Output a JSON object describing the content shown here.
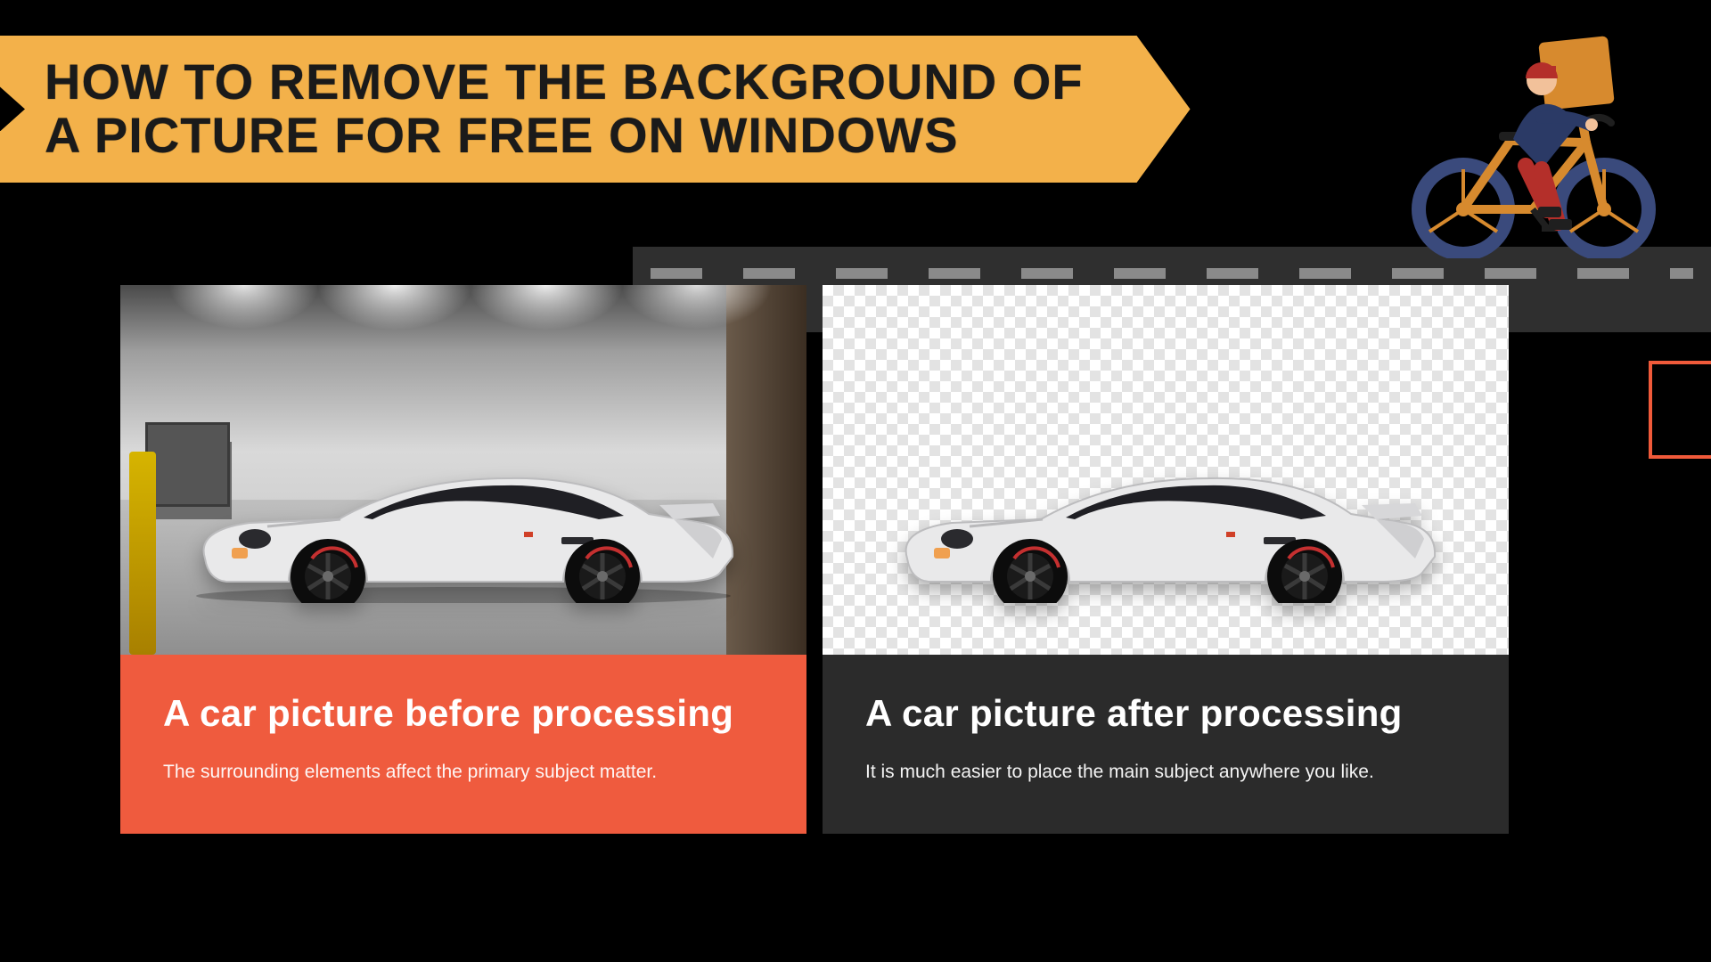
{
  "banner": {
    "title_line1": "HOW TO REMOVE THE BACKGROUND OF",
    "title_line2": "A PICTURE FOR FREE ON WINDOWS"
  },
  "cards": {
    "before": {
      "heading": "A car picture before processing",
      "body": "The surrounding elements affect the primary subject matter."
    },
    "after": {
      "heading": "A car picture after processing",
      "body": "It is much easier to place the main subject anywhere you like."
    }
  },
  "colors": {
    "accent_orange": "#ef5b3e",
    "banner_yellow": "#f3b14a",
    "dark_panel": "#2b2b2b",
    "road": "#2f2f2f"
  },
  "decor": {
    "cyclist_icon": "cyclist-delivery-icon"
  }
}
